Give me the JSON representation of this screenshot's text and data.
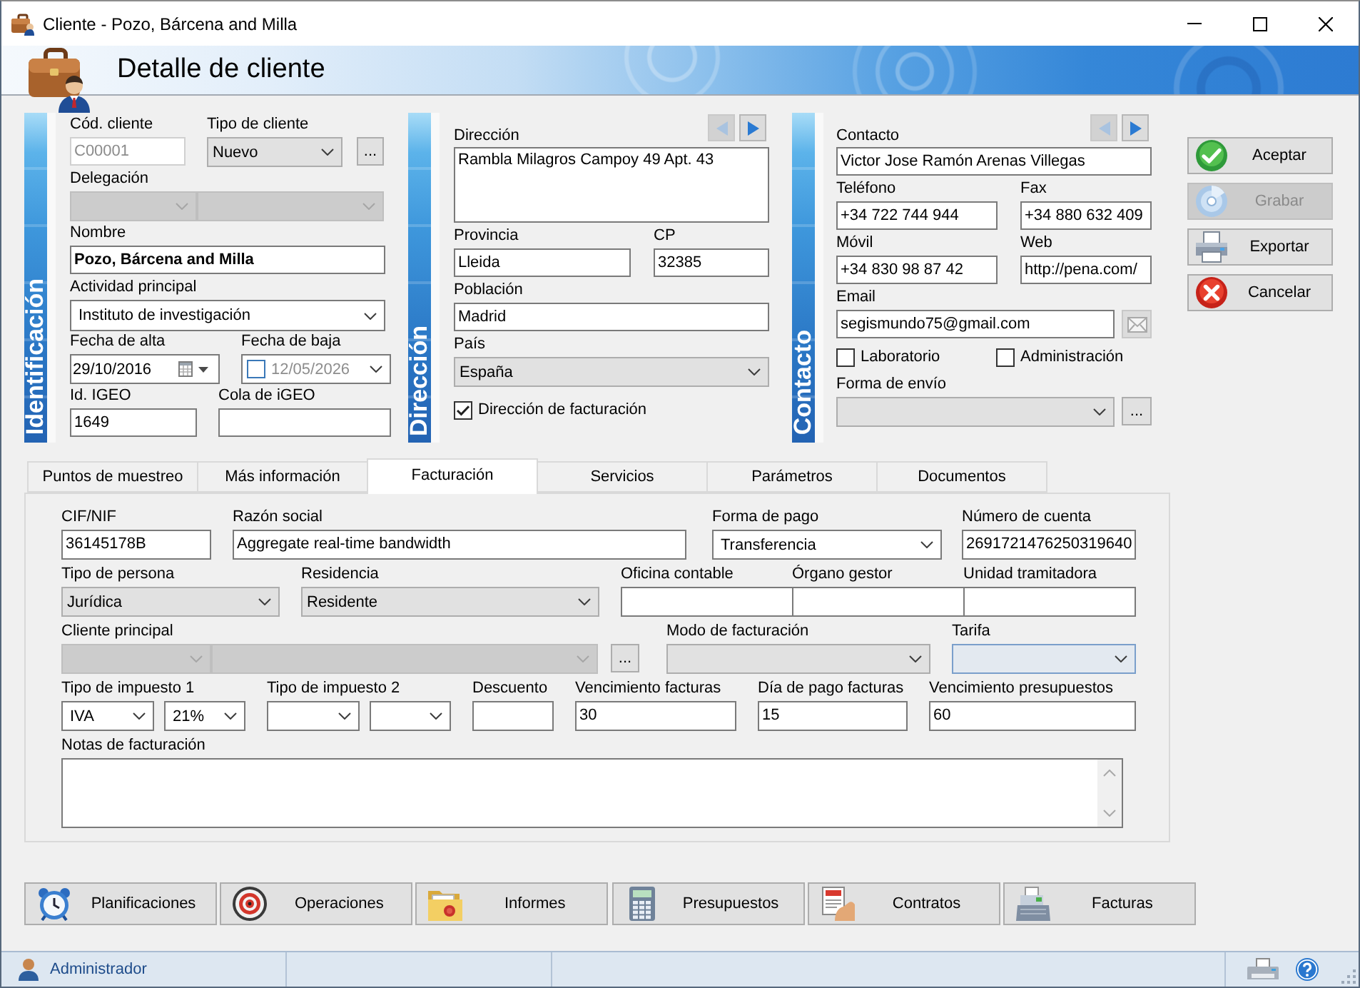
{
  "window": {
    "title": "Cliente - Pozo, Bárcena and Milla"
  },
  "header": {
    "title": "Detalle de cliente"
  },
  "sections": [
    {
      "band": "Identificación",
      "rows": [
        {
          "fields": [
            {
              "label": "Cód. cliente",
              "controls": [
                {
                  "kind": "text",
                  "value": "C00001",
                  "disabled": true
                }
              ]
            },
            {
              "label": "Tipo de cliente",
              "controls": [
                {
                  "kind": "list",
                  "value": "Nuevo",
                  "disabled": false
                }
              ]
            },
            {
              "controls": [
                {
                  "kind": "more",
                  "value": "...",
                  "disabled": false
                }
              ]
            }
          ]
        },
        {
          "fields": [
            {
              "label": "Delegación",
              "controls": [
                {
                  "kind": "list",
                  "disabled": true
                },
                {
                  "kind": "list",
                  "disabled": true
                }
              ]
            }
          ]
        },
        {
          "fields": [
            {
              "label": "Nombre",
              "controls": [
                {
                  "kind": "text",
                  "value": "Pozo, Bárcena and Milla",
                  "disabled": false
                }
              ]
            }
          ]
        },
        {
          "fields": [
            {
              "label": "Actividad principal",
              "controls": [
                {
                  "kind": "combo",
                  "value": "Instituto de investigación",
                  "disabled": false
                }
              ]
            }
          ]
        },
        {
          "fields": [
            {
              "label": "Fecha de alta",
              "controls": [
                {
                  "kind": "date",
                  "value": "29/10/2016",
                  "disabled": false
                }
              ]
            },
            {
              "label": "Fecha de baja",
              "controls": [
                {
                  "kind": "date_check",
                  "value": "12/05/2026",
                  "checked": false
                }
              ]
            }
          ]
        },
        {
          "fields": [
            {
              "label": "Id. IGEO",
              "controls": [
                {
                  "kind": "text",
                  "value": "1649",
                  "disabled": false
                }
              ]
            },
            {
              "label": "Cola de iGEO",
              "controls": [
                {
                  "kind": "text",
                  "disabled": false
                }
              ]
            }
          ]
        }
      ]
    },
    {
      "band": "Dirección",
      "nav": {
        "prev_enabled": false,
        "next_enabled": true
      },
      "rows": [
        {
          "fields": [
            {
              "label": "Dirección",
              "controls": [
                {
                  "kind": "textarea",
                  "value": "Rambla Milagros Campoy 49 Apt. 43",
                  "disabled": false
                }
              ]
            }
          ]
        },
        {
          "fields": [
            {
              "label": "Provincia",
              "controls": [
                {
                  "kind": "text",
                  "value": "Lleida",
                  "disabled": false
                }
              ]
            },
            {
              "label": "CP",
              "controls": [
                {
                  "kind": "text",
                  "value": "32385",
                  "disabled": false
                }
              ]
            }
          ]
        },
        {
          "fields": [
            {
              "label": "Población",
              "controls": [
                {
                  "kind": "text",
                  "value": "Madrid",
                  "disabled": false
                }
              ]
            }
          ]
        },
        {
          "fields": [
            {
              "label": "País",
              "controls": [
                {
                  "kind": "list",
                  "value": "España",
                  "disabled": false
                }
              ]
            }
          ]
        },
        {
          "fields": [
            {
              "controls": [
                {
                  "kind": "checkbox",
                  "label": "Dirección de facturación",
                  "checked": true
                }
              ]
            }
          ]
        }
      ]
    },
    {
      "band": "Contacto",
      "nav": {
        "prev_enabled": false,
        "next_enabled": true
      },
      "rows": [
        {
          "fields": [
            {
              "label": "Contacto",
              "controls": [
                {
                  "kind": "text",
                  "value": "Victor Jose Ramón Arenas Villegas",
                  "disabled": false
                }
              ]
            }
          ]
        },
        {
          "fields": [
            {
              "label": "Teléfono",
              "controls": [
                {
                  "kind": "text",
                  "value": "+34 722 744 944",
                  "disabled": false
                }
              ]
            },
            {
              "label": "Fax",
              "controls": [
                {
                  "kind": "text",
                  "value": "+34 880 632 409",
                  "disabled": false
                }
              ]
            }
          ]
        },
        {
          "fields": [
            {
              "label": "Móvil",
              "controls": [
                {
                  "kind": "text",
                  "value": "+34 830 98 87 42",
                  "disabled": false
                }
              ]
            },
            {
              "label": "Web",
              "controls": [
                {
                  "kind": "text",
                  "value": "http://pena.com/",
                  "disabled": false
                }
              ]
            }
          ]
        },
        {
          "fields": [
            {
              "label": "Email",
              "controls": [
                {
                  "kind": "text",
                  "value": "segismundo75@gmail.com",
                  "disabled": false
                },
                {
                  "kind": "mail",
                  "disabled": true
                }
              ]
            }
          ]
        },
        {
          "fields": [
            {
              "controls": [
                {
                  "kind": "checkbox",
                  "label": "Laboratorio",
                  "checked": false
                }
              ]
            },
            {
              "controls": [
                {
                  "kind": "checkbox",
                  "label": "Administración",
                  "checked": false
                }
              ]
            }
          ]
        },
        {
          "fields": [
            {
              "label": "Forma de envío",
              "controls": [
                {
                  "kind": "list",
                  "disabled": false
                },
                {
                  "kind": "more",
                  "value": "...",
                  "disabled": false
                }
              ]
            }
          ]
        }
      ]
    }
  ],
  "actions": [
    {
      "label": "Aceptar",
      "disabled": false
    },
    {
      "label": "Grabar",
      "disabled": true
    },
    {
      "label": "Exportar",
      "disabled": false
    },
    {
      "label": "Cancelar",
      "disabled": false
    }
  ],
  "tabs": [
    {
      "label": "Puntos de muestreo",
      "selected": false
    },
    {
      "label": "Más información",
      "selected": false
    },
    {
      "label": "Facturación",
      "selected": true
    },
    {
      "label": "Servicios",
      "selected": false
    },
    {
      "label": "Parámetros",
      "selected": false
    },
    {
      "label": "Documentos",
      "selected": false
    }
  ],
  "tab_panel": {
    "rows": [
      {
        "fields": [
          {
            "label": "CIF/NIF",
            "controls": [
              {
                "kind": "text",
                "value": "36145178B",
                "disabled": false
              }
            ]
          },
          {
            "label": "Razón social",
            "controls": [
              {
                "kind": "text",
                "value": "Aggregate real-time bandwidth",
                "disabled": false
              }
            ]
          },
          {
            "label": "Forma de pago",
            "controls": [
              {
                "kind": "combo",
                "value": "Transferencia",
                "disabled": false
              }
            ]
          },
          {
            "label": "Número de cuenta",
            "controls": [
              {
                "kind": "text",
                "value": "2691721476250319640",
                "disabled": false
              }
            ]
          }
        ]
      },
      {
        "fields": [
          {
            "label": "Tipo de persona",
            "controls": [
              {
                "kind": "list",
                "value": "Jurídica",
                "disabled": false
              }
            ]
          },
          {
            "label": "Residencia",
            "controls": [
              {
                "kind": "list",
                "value": "Residente",
                "disabled": false
              }
            ]
          },
          {
            "label": "Oficina contable",
            "controls": [
              {
                "kind": "text",
                "disabled": false
              }
            ]
          },
          {
            "label": "Órgano gestor",
            "controls": [
              {
                "kind": "text",
                "disabled": false
              }
            ]
          },
          {
            "label": "Unidad tramitadora",
            "controls": [
              {
                "kind": "text",
                "disabled": false
              }
            ]
          }
        ]
      },
      {
        "fields": [
          {
            "label": "Cliente principal",
            "controls": [
              {
                "kind": "list",
                "disabled": true
              },
              {
                "kind": "list",
                "disabled": true
              },
              {
                "kind": "more",
                "value": "...",
                "disabled": false
              }
            ]
          },
          {
            "label": "Modo de facturación",
            "controls": [
              {
                "kind": "list",
                "disabled": false
              }
            ]
          },
          {
            "label": "Tarifa",
            "controls": [
              {
                "kind": "list",
                "disabled": false,
                "focused": true
              }
            ]
          }
        ]
      },
      {
        "fields": [
          {
            "label": "Tipo de impuesto 1",
            "controls": [
              {
                "kind": "combo",
                "value": "IVA",
                "disabled": false
              },
              {
                "kind": "combo",
                "value": "21%",
                "disabled": false
              }
            ]
          },
          {
            "label": "Tipo de impuesto 2",
            "controls": [
              {
                "kind": "combo",
                "disabled": false
              },
              {
                "kind": "combo",
                "disabled": false
              }
            ]
          },
          {
            "label": "Descuento",
            "controls": [
              {
                "kind": "text",
                "disabled": false
              }
            ]
          },
          {
            "label": "Vencimiento facturas",
            "controls": [
              {
                "kind": "text",
                "value": "30",
                "disabled": false
              }
            ]
          },
          {
            "label": "Día de pago facturas",
            "controls": [
              {
                "kind": "text",
                "value": "15",
                "disabled": false
              }
            ]
          },
          {
            "label": "Vencimiento presupuestos",
            "controls": [
              {
                "kind": "text",
                "value": "60",
                "disabled": false
              }
            ]
          }
        ]
      },
      {
        "fields": [
          {
            "label": "Notas de facturación",
            "controls": [
              {
                "kind": "textarea",
                "disabled": false
              }
            ]
          }
        ]
      }
    ]
  },
  "toolbar": [
    "Planificaciones",
    "Operaciones",
    "Informes",
    "Presupuestos",
    "Contratos",
    "Facturas"
  ],
  "status_bar": {
    "user": "Administrador"
  }
}
